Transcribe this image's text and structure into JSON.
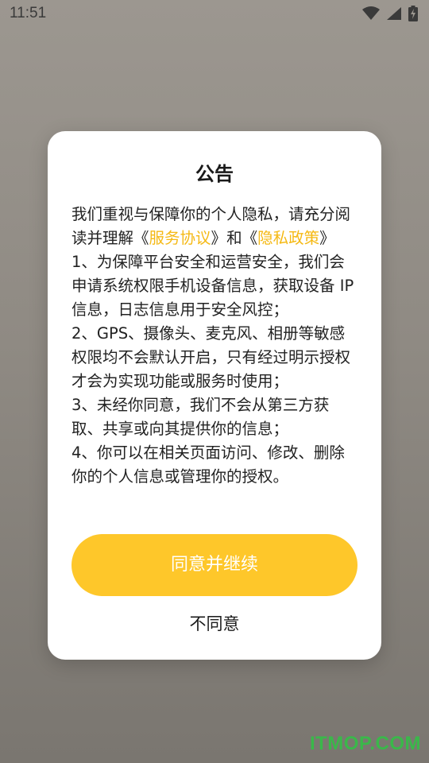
{
  "status_bar": {
    "time": "11:51",
    "icons": [
      "wifi-icon",
      "signal-icon",
      "battery-charging-icon"
    ]
  },
  "dialog": {
    "title": "公告",
    "intro_1": "我们重视与保障你的个人隐私，请充分阅读并理解",
    "open_quote_1": "《",
    "link_service": "服务协议",
    "close_quote_1": "》",
    "and": "和",
    "open_quote_2": "《",
    "link_privacy": "隐私政策",
    "close_quote_2": "》",
    "item_1": "1、为保障平台安全和运营安全，我们会申请系统权限手机设备信息，获取设备 IP 信息，日志信息用于安全风控；",
    "item_2": "2、GPS、摄像头、麦克风、相册等敏感权限均不会默认开启，只有经过明示授权才会为实现功能或服务时使用；",
    "item_3": "3、未经你同意，我们不会从第三方获取、共享或向其提供你的信息；",
    "item_4": "4、你可以在相关页面访问、修改、删除你的个人信息或管理你的授权。",
    "agree_label": "同意并继续",
    "disagree_label": "不同意"
  },
  "watermark": "ITMOP.COM",
  "colors": {
    "accent": "#fec72a",
    "link": "#f5b914",
    "watermark": "#3ab84a"
  }
}
